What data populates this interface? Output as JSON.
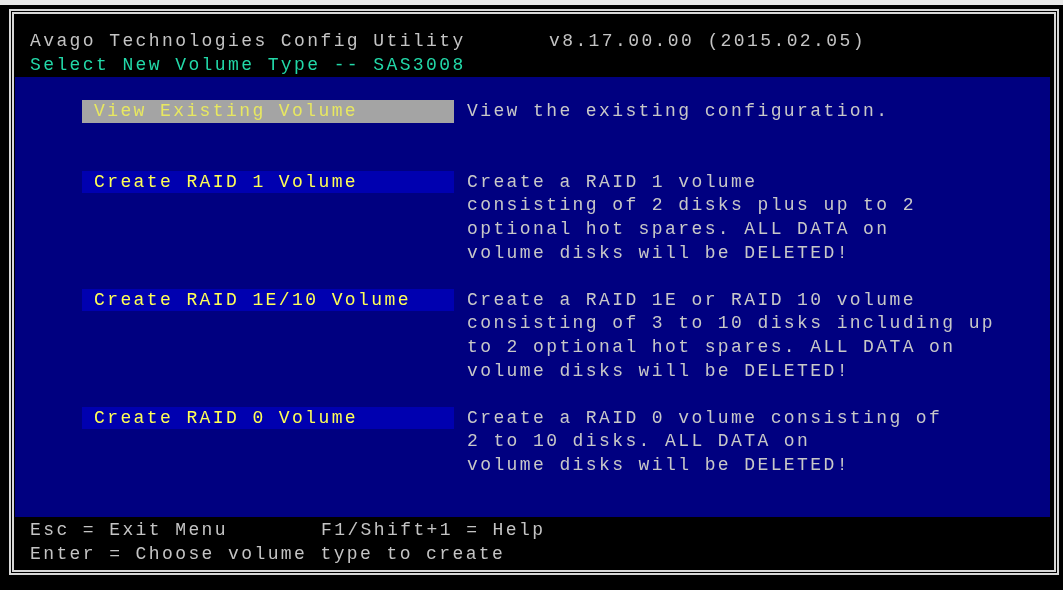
{
  "header": {
    "title": "Avago Technologies Config Utility",
    "version": "v8.17.00.00 (2015.02.05)",
    "subtitle": "Select New Volume Type -- SAS3008"
  },
  "menu": [
    {
      "label": "View Existing Volume",
      "selected": true,
      "description": [
        "View the existing configuration."
      ]
    },
    {
      "label": "Create RAID 1 Volume",
      "selected": false,
      "description": [
        "Create a RAID 1 volume",
        "consisting of 2 disks plus up to 2",
        "optional hot spares. ALL DATA on",
        "volume disks will be DELETED!"
      ]
    },
    {
      "label": "Create RAID 1E/10 Volume",
      "selected": false,
      "description": [
        "Create a RAID 1E or RAID 10 volume",
        "consisting of 3 to 10 disks including up",
        "to 2 optional hot spares. ALL DATA on",
        "volume disks will be DELETED!"
      ]
    },
    {
      "label": "Create RAID 0 Volume",
      "selected": false,
      "description": [
        "Create a RAID 0 volume consisting of",
        "2 to 10 disks. ALL DATA on",
        "volume disks will be DELETED!"
      ]
    }
  ],
  "footer": {
    "keys": [
      "Esc = Exit Menu",
      "F1/Shift+1 = Help"
    ],
    "hint": "Enter = Choose volume type to create"
  }
}
